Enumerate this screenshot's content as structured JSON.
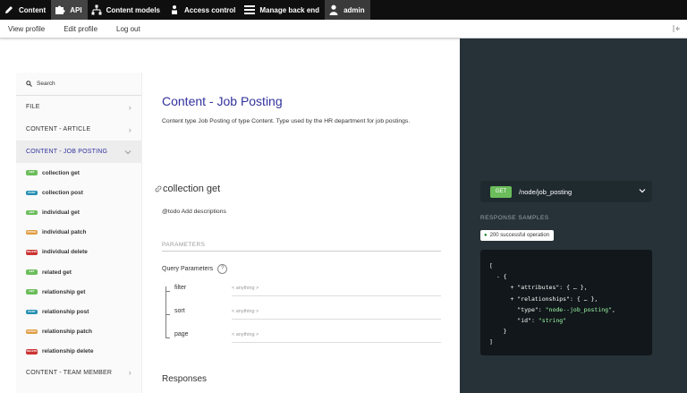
{
  "toolbar": {
    "items": [
      {
        "label": "Content",
        "icon": "pencil-icon"
      },
      {
        "label": "API",
        "icon": "puzzle-icon"
      },
      {
        "label": "Content models",
        "icon": "hierarchy-icon"
      },
      {
        "label": "Access control",
        "icon": "person-icon"
      },
      {
        "label": "Manage back end",
        "icon": "menu-icon"
      },
      {
        "label": "admin",
        "icon": "user-icon"
      }
    ]
  },
  "subbar": {
    "links": [
      "View profile",
      "Edit profile",
      "Log out"
    ]
  },
  "sidebar": {
    "search_placeholder": "Search",
    "sections": [
      {
        "label": "FILE"
      },
      {
        "label": "CONTENT - ARTICLE"
      },
      {
        "label": "CONTENT - JOB POSTING"
      }
    ],
    "operations": [
      {
        "method": "GET",
        "label": "collection get",
        "color": "#6bbd5b"
      },
      {
        "method": "POST",
        "label": "collection post",
        "color": "#248fb2"
      },
      {
        "method": "GET",
        "label": "individual get",
        "color": "#6bbd5b"
      },
      {
        "method": "PATCH",
        "label": "individual patch",
        "color": "#e09d43"
      },
      {
        "method": "DELETE",
        "label": "individual delete",
        "color": "#cc3333"
      },
      {
        "method": "GET",
        "label": "related get",
        "color": "#6bbd5b"
      },
      {
        "method": "GET",
        "label": "relationship get",
        "color": "#6bbd5b"
      },
      {
        "method": "POST",
        "label": "relationship post",
        "color": "#248fb2"
      },
      {
        "method": "PATCH",
        "label": "relationship patch",
        "color": "#e09d43"
      },
      {
        "method": "DELETE",
        "label": "relationship delete",
        "color": "#cc3333"
      }
    ],
    "last_section": "CONTENT - TEAM MEMBER"
  },
  "main": {
    "title": "Content - Job Posting",
    "description": "Content type Job Posting of type Content. Type used by the HR department for job postings.",
    "operation_title": "collection get",
    "operation_desc": "@todo Add descriptions",
    "params_heading": "PARAMETERS",
    "query_params_label": "Query Parameters",
    "info_glyph": "?",
    "params": [
      {
        "name": "filter",
        "value": "< anything >"
      },
      {
        "name": "sort",
        "value": "< anything >"
      },
      {
        "name": "page",
        "value": "< anything >"
      }
    ],
    "responses_label": "Responses"
  },
  "right": {
    "method": "GET",
    "path": "/node/job_posting",
    "samples_label": "RESPONSE SAMPLES",
    "status": "200 successful operation",
    "code_lines": [
      "[",
      "  - {",
      "      + \"attributes\": { … },",
      "      + \"relationships\": { … },",
      "        \"type\": ",
      "        \"id\": "
    ],
    "code_type_value": "\"node--job_posting\"",
    "code_id_value": "\"string\"",
    "code_close_brace": "    }",
    "code_close_bracket": "]"
  }
}
